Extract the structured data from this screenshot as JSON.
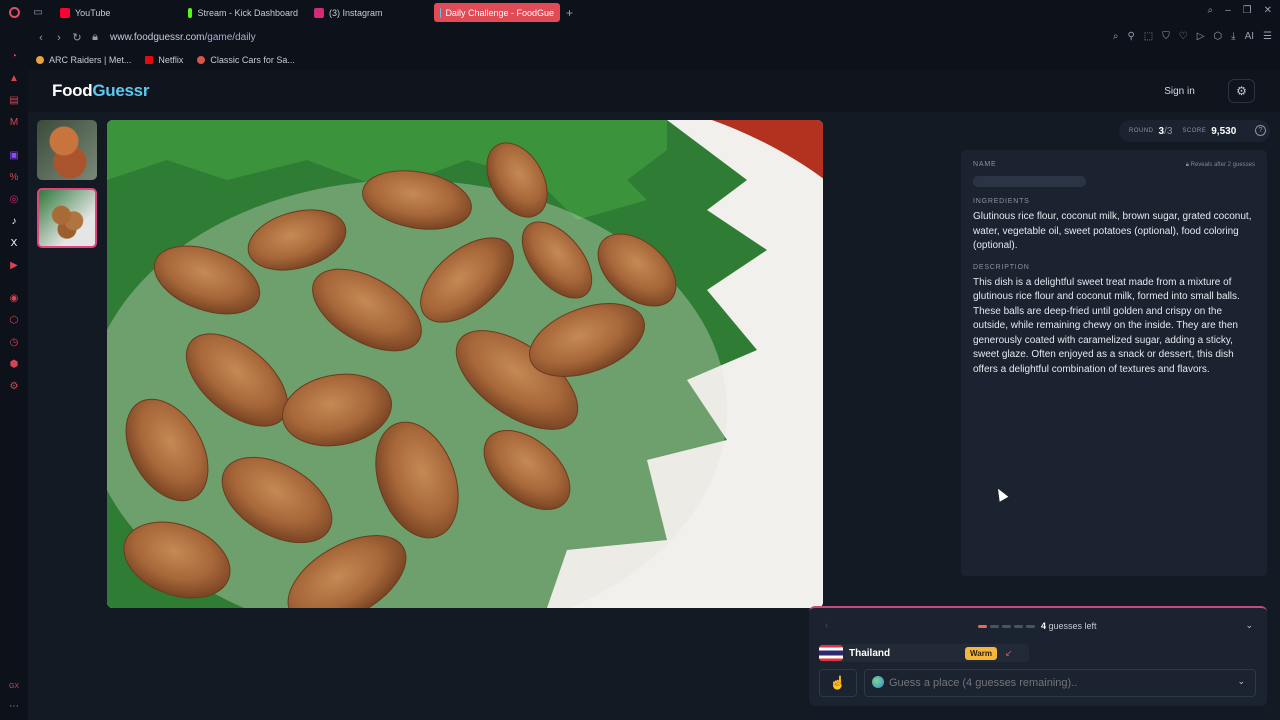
{
  "browser": {
    "tabs": [
      {
        "label": "YouTube",
        "color": "#ff0033"
      },
      {
        "label": "Stream - Kick Dashboard",
        "color": "#53fc18"
      },
      {
        "label": "(3) Instagram",
        "color": "#d62976"
      },
      {
        "label": "Daily Challenge - FoodGue",
        "color": "#5ec8f0",
        "active": true
      }
    ],
    "url_host": "www.foodguessr.com",
    "url_path": "/game/daily",
    "ai_label": "AI",
    "bookmarks": [
      {
        "label": "ARC Raiders | Met...",
        "color": "#e8a33b"
      },
      {
        "label": "Netflix",
        "color": "#e50914"
      },
      {
        "label": "Classic Cars for Sa...",
        "color": "#d9534f"
      }
    ],
    "sidebar_bottom_label": "GX"
  },
  "site": {
    "logo_food": "Food",
    "logo_guessr": "Guessr",
    "signin_label": "Sign in"
  },
  "stats": {
    "round_label": "ROUND",
    "round_value": "3",
    "round_total": "/3",
    "score_label": "SCORE",
    "score_value": "9,530"
  },
  "info": {
    "name_label": "NAME",
    "reveal_note": "Reveals after 2 guesses",
    "ingredients_label": "INGREDIENTS",
    "ingredients_text": "Glutinous rice flour, coconut milk, brown sugar, grated coconut, water, vegetable oil, sweet potatoes (optional), food coloring (optional).",
    "description_label": "DESCRIPTION",
    "description_text": "This dish is a delightful sweet treat made from a mixture of glutinous rice flour and coconut milk, formed into small balls. These balls are deep-fried until golden and crispy on the outside, while remaining chewy on the inside. They are then generously coated with caramelized sugar, adding a sticky, sweet glaze. Often enjoyed as a snack or dessert, this dish offers a delightful combination of textures and flavors."
  },
  "guess": {
    "guesses_left_count": "4",
    "guesses_left_label": "guesses left",
    "previous": [
      {
        "country": "Thailand",
        "temperature": "Warm",
        "temperature_color": "#f4b73b"
      }
    ],
    "input_placeholder": "Guess a place (4 guesses remaining)..",
    "progress": {
      "used": 1,
      "total": 5
    }
  }
}
